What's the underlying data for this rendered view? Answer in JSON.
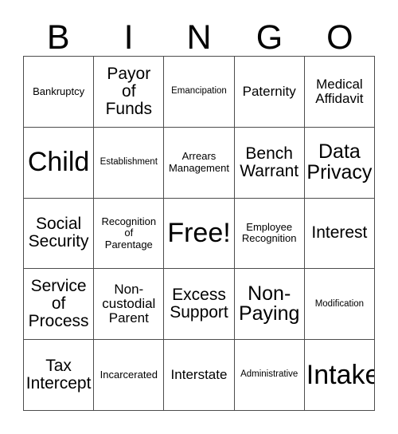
{
  "card": {
    "title_letters": [
      "B",
      "I",
      "N",
      "G",
      "O"
    ],
    "free_space_label": "Free!",
    "colors": {
      "background": "#ffffff",
      "text": "#000000",
      "grid_line": "#4d4d4d"
    },
    "rows": [
      [
        {
          "label": "Bankruptcy",
          "size": "sm"
        },
        {
          "label": "Payor\nof\nFunds",
          "size": "lg"
        },
        {
          "label": "Emancipation",
          "size": "xs"
        },
        {
          "label": "Paternity",
          "size": "md"
        },
        {
          "label": "Medical\nAffidavit",
          "size": "md"
        }
      ],
      [
        {
          "label": "Child",
          "size": "xxl"
        },
        {
          "label": "Establishment",
          "size": "xs"
        },
        {
          "label": "Arrears\nManagement",
          "size": "sm"
        },
        {
          "label": "Bench\nWarrant",
          "size": "lg"
        },
        {
          "label": "Data\nPrivacy",
          "size": "xl"
        }
      ],
      [
        {
          "label": "Social\nSecurity",
          "size": "lg"
        },
        {
          "label": "Recognition\nof\nParentage",
          "size": "sm"
        },
        {
          "label": "Free!",
          "size": "xxl"
        },
        {
          "label": "Employee\nRecognition",
          "size": "sm"
        },
        {
          "label": "Interest",
          "size": "lg"
        }
      ],
      [
        {
          "label": "Service\nof\nProcess",
          "size": "lg"
        },
        {
          "label": "Non-\ncustodial\nParent",
          "size": "md"
        },
        {
          "label": "Excess\nSupport",
          "size": "lg"
        },
        {
          "label": "Non-\nPaying",
          "size": "xl"
        },
        {
          "label": "Modification",
          "size": "xs"
        }
      ],
      [
        {
          "label": "Tax\nIntercept",
          "size": "lg"
        },
        {
          "label": "Incarcerated",
          "size": "sm"
        },
        {
          "label": "Interstate",
          "size": "md"
        },
        {
          "label": "Administrative",
          "size": "xs"
        },
        {
          "label": "Intake",
          "size": "xxl"
        }
      ]
    ]
  }
}
